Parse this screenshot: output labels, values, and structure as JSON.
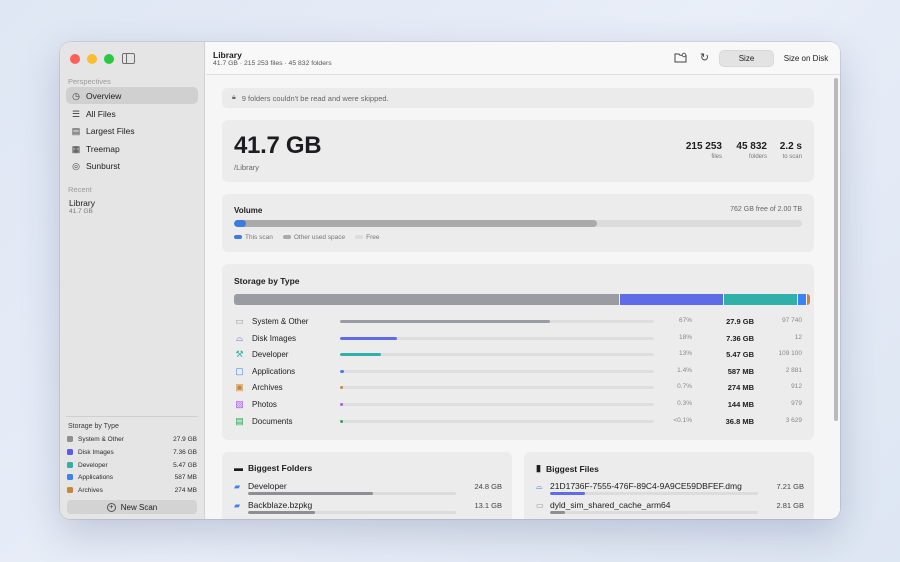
{
  "sidebar": {
    "perspectives_label": "Perspectives",
    "items": [
      {
        "label": "Overview",
        "icon": "clock-icon"
      },
      {
        "label": "All Files",
        "icon": "list-icon"
      },
      {
        "label": "Largest Files",
        "icon": "largest-files-icon"
      },
      {
        "label": "Treemap",
        "icon": "treemap-icon"
      },
      {
        "label": "Sunburst",
        "icon": "sunburst-icon"
      }
    ],
    "recent_label": "Recent",
    "recent": {
      "name": "Library",
      "size": "41.7 GB"
    },
    "storage_label": "Storage by Type",
    "storage": [
      {
        "name": "System & Other",
        "size": "27.9 GB",
        "color": "#8e8e93"
      },
      {
        "name": "Disk Images",
        "size": "7.36 GB",
        "color": "#5e5ce6"
      },
      {
        "name": "Developer",
        "size": "5.47 GB",
        "color": "#30b0a8"
      },
      {
        "name": "Applications",
        "size": "587 MB",
        "color": "#3b82f6"
      },
      {
        "name": "Archives",
        "size": "274 MB",
        "color": "#c8873a"
      }
    ],
    "new_scan_label": "New Scan"
  },
  "toolbar": {
    "title": "Library",
    "subtitle": "41.7 GB · 215 253 files · 45 832 folders",
    "seg_size": "Size",
    "seg_disk": "Size on Disk"
  },
  "warning": "9 folders couldn't be read and were skipped.",
  "summary": {
    "size": "41.7 GB",
    "path": "/Library",
    "files_value": "215 253",
    "files_label": "files",
    "folders_value": "45 832",
    "folders_label": "folders",
    "time_value": "2.2 s",
    "time_label": "to scan"
  },
  "volume": {
    "title": "Volume",
    "free_text": "762 GB free of 2.00 TB",
    "this_scan_fraction": 0.0209,
    "other_used_fraction": 0.619,
    "legend": [
      "This scan",
      "Other used space",
      "Free"
    ],
    "colors": {
      "scan": "#3e7be0",
      "other": "#aaaaaa",
      "free": "#dcdcdc"
    }
  },
  "storage_by_type": {
    "title": "Storage by Type",
    "rows": [
      {
        "name": "System & Other",
        "pct": "67%",
        "size": "27.9 GB",
        "count": "97 740",
        "fraction": 0.67,
        "color": "#9a9ba3",
        "icon": "system-icon"
      },
      {
        "name": "Disk Images",
        "pct": "18%",
        "size": "7.36 GB",
        "count": "12",
        "fraction": 0.18,
        "color": "#5e6ce8",
        "icon": "disk-image-icon"
      },
      {
        "name": "Developer",
        "pct": "13%",
        "size": "5.47 GB",
        "count": "109 100",
        "fraction": 0.13,
        "color": "#30b0a8",
        "icon": "hammer-icon"
      },
      {
        "name": "Applications",
        "pct": "1.4%",
        "size": "587 MB",
        "count": "2 881",
        "fraction": 0.014,
        "color": "#3b82f6",
        "icon": "app-icon"
      },
      {
        "name": "Archives",
        "pct": "0.7%",
        "size": "274 MB",
        "count": "912",
        "fraction": 0.007,
        "color": "#c8873a",
        "icon": "archive-icon"
      },
      {
        "name": "Photos",
        "pct": "0.3%",
        "size": "144 MB",
        "count": "979",
        "fraction": 0.003,
        "color": "#a855f7",
        "icon": "photo-icon"
      },
      {
        "name": "Documents",
        "pct": "<0.1%",
        "size": "36.8 MB",
        "count": "3 629",
        "fraction": 0.001,
        "color": "#22a855",
        "icon": "document-icon"
      }
    ]
  },
  "biggest_folders": {
    "title": "Biggest Folders",
    "rows": [
      {
        "name": "Developer",
        "size": "24.8 GB",
        "fraction": 0.6
      },
      {
        "name": "Backblaze.bzpkg",
        "size": "13.1 GB",
        "fraction": 0.32
      }
    ]
  },
  "biggest_files": {
    "title": "Biggest Files",
    "rows": [
      {
        "name": "21D1736F-7555-476F-89C4-9A9CE59DBFEF.dmg",
        "size": "7.21 GB",
        "fraction": 0.17,
        "icon": "disk-image-icon"
      },
      {
        "name": "dyld_sim_shared_cache_arm64",
        "size": "2.81 GB",
        "fraction": 0.07,
        "icon": "file-icon"
      }
    ]
  }
}
